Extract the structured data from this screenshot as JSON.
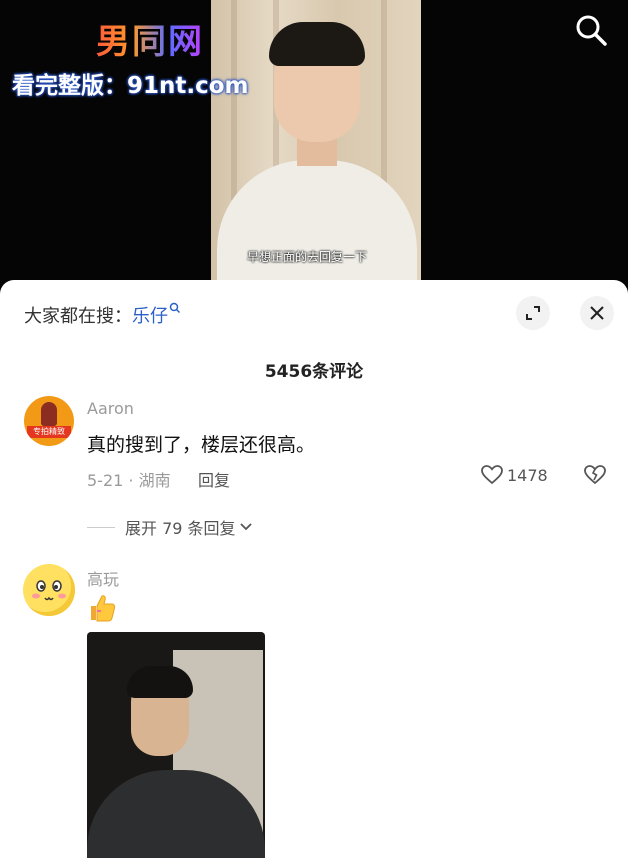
{
  "video": {
    "watermark_logo": "男同网",
    "watermark_url": "看完整版：91nt.com",
    "subtitle": "早想正面的去回复一下"
  },
  "sheet": {
    "search_prefix": "大家都在搜：",
    "search_keyword": "乐仔",
    "comment_count": "5456条评论",
    "comments": [
      {
        "username": "Aaron",
        "avatar_text": "专拍精致",
        "text": "真的搜到了，楼层还很高。",
        "meta": "5-21 · 湖南",
        "reply_label": "回复",
        "likes": "1478",
        "expand_replies": "展开 79 条回复"
      },
      {
        "username": "高玩",
        "emoji": "thumbs-up-emoji"
      }
    ]
  },
  "colors": {
    "keyword": "#2c60c7",
    "accent_watermark": "#2b57c9"
  }
}
